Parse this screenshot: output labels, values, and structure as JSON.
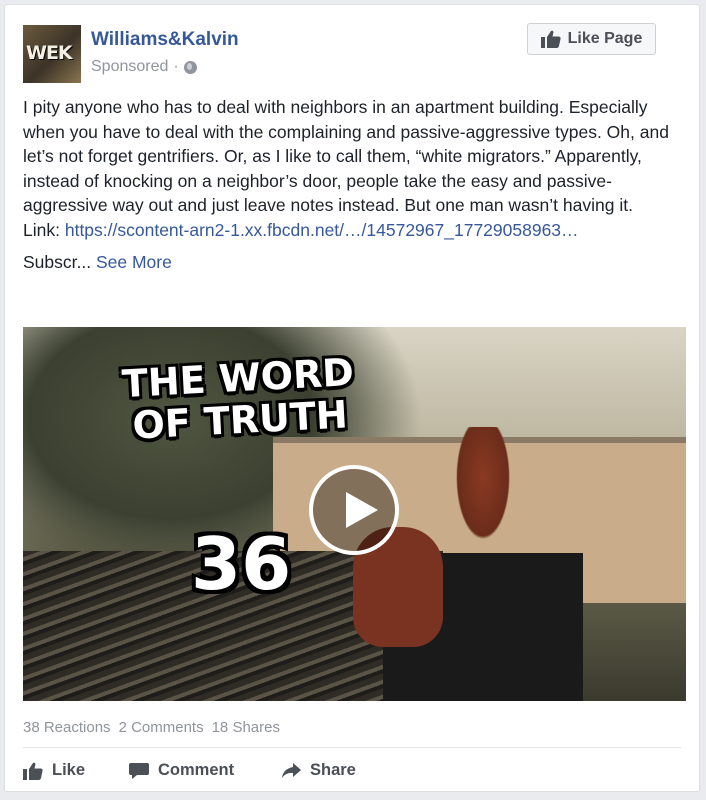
{
  "post": {
    "page_name": "Williams&Kalvin",
    "avatar_text": "WEK",
    "sponsored": "Sponsored",
    "separator": "·",
    "like_page_label": "Like Page",
    "body": [
      "I pity anyone who has to deal with neighbors in an apartment building. Especially when you have to deal with the complaining and passive-aggressive types. Oh, and let’s not forget gentrifiers. Or, as I like to call them, “white migrators.” Apparently, instead of knocking on a neighbor’s door, people take the easy and passive-aggressive way out and just leave notes instead. But one man wasn’t having it."
    ],
    "link_label": "Link:",
    "link_url": "https://scontent-arn2-1.xx.fbcdn.net/…/14572967_17729058963…",
    "truncated_text": "Subscr...",
    "see_more": "See More"
  },
  "video": {
    "title_line1": "THE WORD",
    "title_line2": "OF TRUTH",
    "episode": "36"
  },
  "stats": {
    "reactions": "38 Reactions",
    "comments": "2 Comments",
    "shares": "18 Shares"
  },
  "actions": {
    "like": "Like",
    "comment": "Comment",
    "share": "Share"
  },
  "colors": {
    "link": "#365899",
    "text": "#1d2129",
    "muted": "#90949c",
    "background": "#e9ebee"
  }
}
